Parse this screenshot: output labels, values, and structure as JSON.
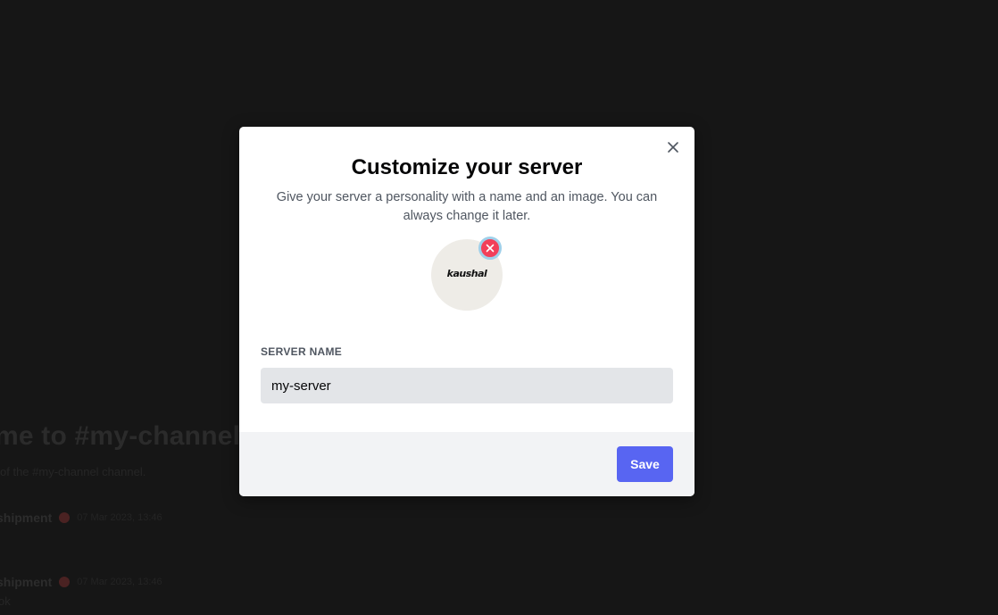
{
  "background": {
    "welcome_text": "me to #my-channel!",
    "sub_text": "of the #my-channel channel.",
    "messages": [
      {
        "author": "shipment",
        "time": "07 Mar 2023, 13:46",
        "text": ""
      },
      {
        "author": "shipment",
        "time": "07 Mar 2023, 13:46",
        "text": "ok"
      }
    ]
  },
  "modal": {
    "title": "Customize your server",
    "subtitle": "Give your server a personality with a name and an image. You can always change it later.",
    "avatar_text": "kaushal",
    "field_label": "SERVER NAME",
    "server_name_value": "my-server",
    "save_label": "Save",
    "icons": {
      "close": "close-icon",
      "remove_image": "remove-icon"
    }
  },
  "colors": {
    "accent": "#5865f2",
    "danger": "#f23f5a",
    "overlay": "#161616",
    "footer": "#f2f3f5",
    "input_bg": "#e3e5e8"
  }
}
